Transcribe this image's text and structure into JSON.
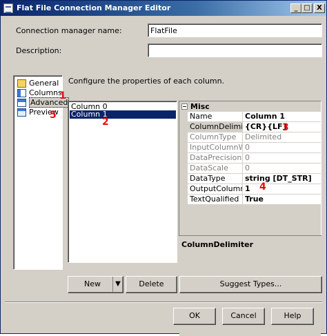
{
  "window": {
    "title": "Flat File Connection Manager Editor",
    "controls": {
      "minimize": "_",
      "maximize": "□",
      "close": "X"
    }
  },
  "form": {
    "connection_name_label": "Connection manager name:",
    "connection_name_value": "FlatFile",
    "description_label": "Description:",
    "description_value": ""
  },
  "nav": {
    "items": [
      {
        "label": "General",
        "icon": "general-icon"
      },
      {
        "label": "Columns",
        "icon": "columns-icon"
      },
      {
        "label": "Advanced",
        "icon": "advanced-icon",
        "selected": true
      },
      {
        "label": "Preview",
        "icon": "preview-icon"
      }
    ]
  },
  "instructions": "Configure the properties of each column.",
  "columns_list": {
    "items": [
      "Column 0",
      "Column 1"
    ],
    "selected_index": 1
  },
  "properties": {
    "category": "Misc",
    "category_toggle": "⊟",
    "rows": [
      {
        "name": "Name",
        "value": "Column 1"
      },
      {
        "name": "ColumnDelimiter",
        "value": "{CR}{LF}"
      },
      {
        "name": "ColumnType",
        "value": "Delimited"
      },
      {
        "name": "InputColumnWidth",
        "value": "0"
      },
      {
        "name": "DataPrecision",
        "value": "0"
      },
      {
        "name": "DataScale",
        "value": "0"
      },
      {
        "name": "DataType",
        "value": "string [DT_STR]"
      },
      {
        "name": "OutputColumnWidth",
        "value": "1"
      },
      {
        "name": "TextQualified",
        "value": "True"
      }
    ]
  },
  "description_panel": {
    "title": "ColumnDelimiter"
  },
  "buttons": {
    "new": "New",
    "new_dropdown": "▼",
    "delete": "Delete",
    "suggest": "Suggest Types...",
    "ok": "OK",
    "cancel": "Cancel",
    "help": "Help"
  },
  "annotations": [
    "1",
    "2",
    "3",
    "4",
    "5"
  ],
  "colors": {
    "title_start": "#0a246a",
    "title_end": "#a6caf0",
    "selection": "#0a246a",
    "annotation_red": "#e01010",
    "dialog_face": "#d4d0c8"
  }
}
